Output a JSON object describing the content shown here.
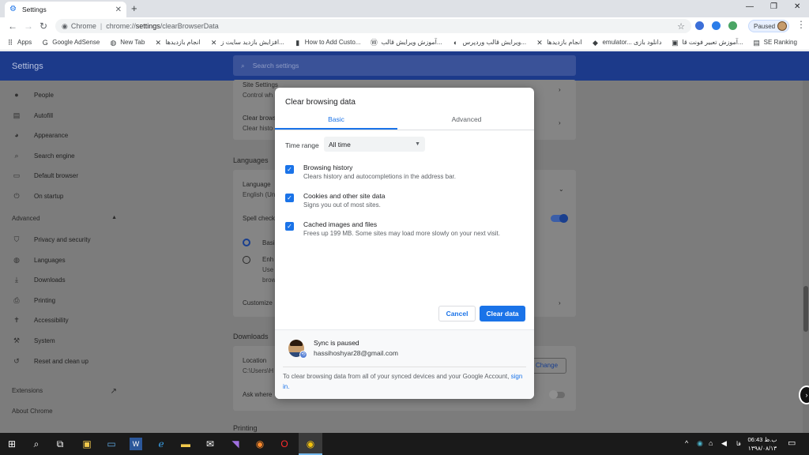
{
  "browser": {
    "tab_title": "Settings",
    "url_scheme": "Chrome",
    "url_host": "chrome://",
    "url_bold": "settings",
    "url_path": "/clearBrowserData",
    "profile_label": "Paused"
  },
  "bookmarks": [
    {
      "icon": "apps-icon",
      "glyph": "⠿",
      "label": "Apps"
    },
    {
      "icon": "google-icon",
      "glyph": "G",
      "label": "Google AdSense"
    },
    {
      "icon": "globe-icon",
      "glyph": "◍",
      "label": "New Tab"
    },
    {
      "icon": "x-icon",
      "glyph": "✕",
      "label": "انجام بازدیدها"
    },
    {
      "icon": "x-icon",
      "glyph": "✕",
      "label": "افزایش بازدید سایت ز..."
    },
    {
      "icon": "bookmark-icon",
      "glyph": "▮",
      "label": "How to Add Custo..."
    },
    {
      "icon": "wordpress-icon",
      "glyph": "Ⓦ",
      "label": "آموزش ویرایش قالب..."
    },
    {
      "icon": "moon-icon",
      "glyph": "◐",
      "label": "ویرایش قالب وردپرس..."
    },
    {
      "icon": "x-icon",
      "glyph": "✕",
      "label": "انجام بازدیدها"
    },
    {
      "icon": "gamepad-icon",
      "glyph": "◆",
      "label": "emulator... دانلود بازی"
    },
    {
      "icon": "it-icon",
      "glyph": "▣",
      "label": "آموزش تعبیر فونت قا..."
    },
    {
      "icon": "chart-icon",
      "glyph": "▤",
      "label": "SE Ranking"
    }
  ],
  "settings": {
    "header_title": "Settings",
    "search_placeholder": "Search settings",
    "sidebar": [
      {
        "icon": "person-icon",
        "glyph": "●",
        "label": "People"
      },
      {
        "icon": "clipboard-icon",
        "glyph": "▤",
        "label": "Autofill"
      },
      {
        "icon": "palette-icon",
        "glyph": "◕",
        "label": "Appearance"
      },
      {
        "icon": "search-icon",
        "glyph": "⌕",
        "label": "Search engine"
      },
      {
        "icon": "browser-icon",
        "glyph": "▭",
        "label": "Default browser"
      },
      {
        "icon": "power-icon",
        "glyph": "⏻",
        "label": "On startup"
      }
    ],
    "advanced_label": "Advanced",
    "advanced_items": [
      {
        "icon": "shield-icon",
        "glyph": "⛉",
        "label": "Privacy and security"
      },
      {
        "icon": "globe-icon",
        "glyph": "◍",
        "label": "Languages"
      },
      {
        "icon": "download-icon",
        "glyph": "⤓",
        "label": "Downloads"
      },
      {
        "icon": "printer-icon",
        "glyph": "⎙",
        "label": "Printing"
      },
      {
        "icon": "accessibility-icon",
        "glyph": "✝",
        "label": "Accessibility"
      },
      {
        "icon": "wrench-icon",
        "glyph": "⚒",
        "label": "System"
      },
      {
        "icon": "reset-icon",
        "glyph": "↺",
        "label": "Reset and clean up"
      }
    ],
    "extensions_label": "Extensions",
    "about_label": "About Chrome",
    "bg": {
      "site_settings": "Site Settings",
      "control_what": "Control wh",
      "clear_brows": "Clear brows",
      "clear_hist": "Clear histo",
      "languages": "Languages",
      "language": "Language",
      "english": "English (Un",
      "spell_check": "Spell check",
      "basic": "Basi",
      "enhanced": "Enh",
      "uses": "Use",
      "brow": "brow",
      "customize": "Customize",
      "downloads": "Downloads",
      "location": "Location",
      "location_path": "C:\\Users\\H",
      "change": "Change",
      "ask_where": "Ask where",
      "printing": "Printing"
    }
  },
  "dialog": {
    "title": "Clear browsing data",
    "tab_basic": "Basic",
    "tab_advanced": "Advanced",
    "time_range_label": "Time range",
    "time_range_value": "All time",
    "options": [
      {
        "title": "Browsing history",
        "desc": "Clears history and autocompletions in the address bar.",
        "checked": true
      },
      {
        "title": "Cookies and other site data",
        "desc": "Signs you out of most sites.",
        "checked": true
      },
      {
        "title": "Cached images and files",
        "desc": "Frees up 199 MB. Some sites may load more slowly on your next visit.",
        "checked": true
      }
    ],
    "cancel_label": "Cancel",
    "clear_label": "Clear data",
    "sync_title": "Sync is paused",
    "sync_email": "hassihoshyar28@gmail.com",
    "sync_note": "To clear browsing data from all of your synced devices and your Google Account,",
    "sync_link": "sign in."
  },
  "taskbar": {
    "time": "06:43 ب.ظ",
    "date": "۱۳۹۸/۰۸/۱۳",
    "lang": "فا"
  },
  "colors": {
    "accent": "#1a73e8",
    "header": "#1c3a8a",
    "overlay": "#7c7c7c"
  }
}
